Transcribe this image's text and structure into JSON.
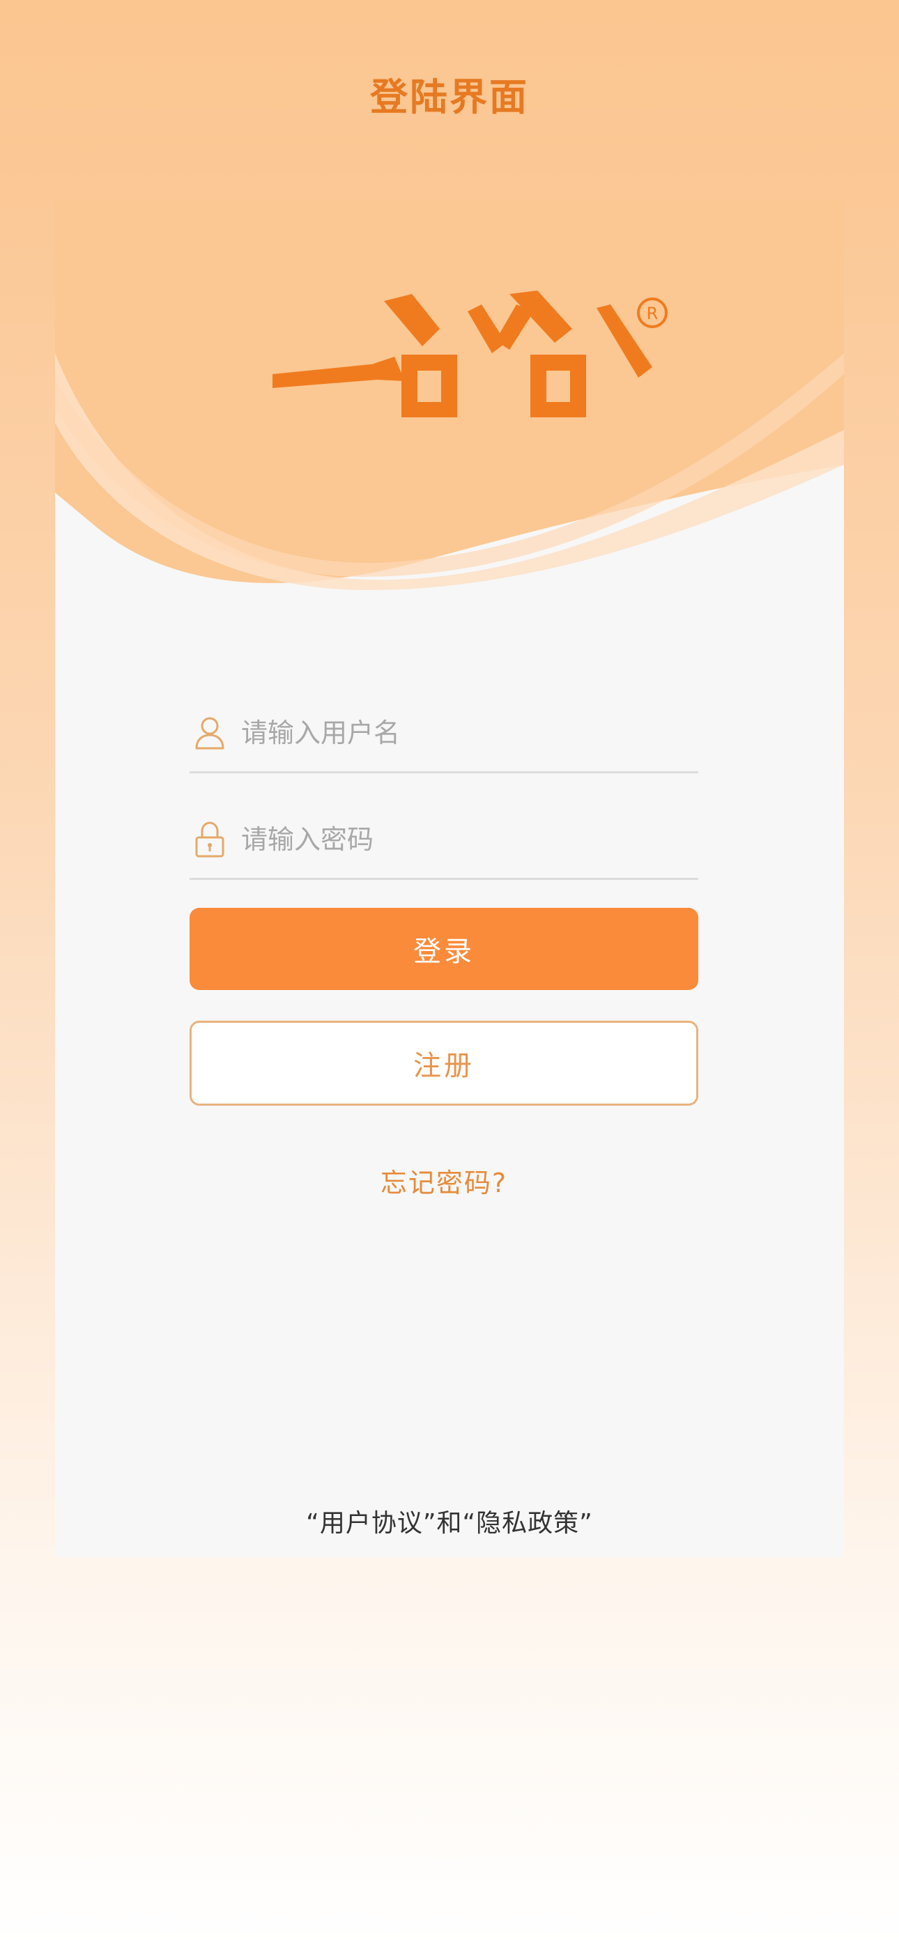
{
  "header": {
    "title": "登陆界面"
  },
  "login_form": {
    "username_placeholder": "请输入用户名",
    "username_value": "",
    "password_placeholder": "请输入密码",
    "password_value": "",
    "username_icon": "user-icon",
    "password_icon": "lock-icon",
    "login_label": "登录",
    "register_label": "注册",
    "forgot_label": "忘记密码?"
  },
  "footer": {
    "user_agreement_link": "“用户协议”",
    "and_text": "和",
    "privacy_policy_link": "“隐私政策”"
  },
  "colors": {
    "accent": "#fa8b3a",
    "title": "#e67a22",
    "link": "#e68b3a",
    "logo": "#f07b1e"
  }
}
